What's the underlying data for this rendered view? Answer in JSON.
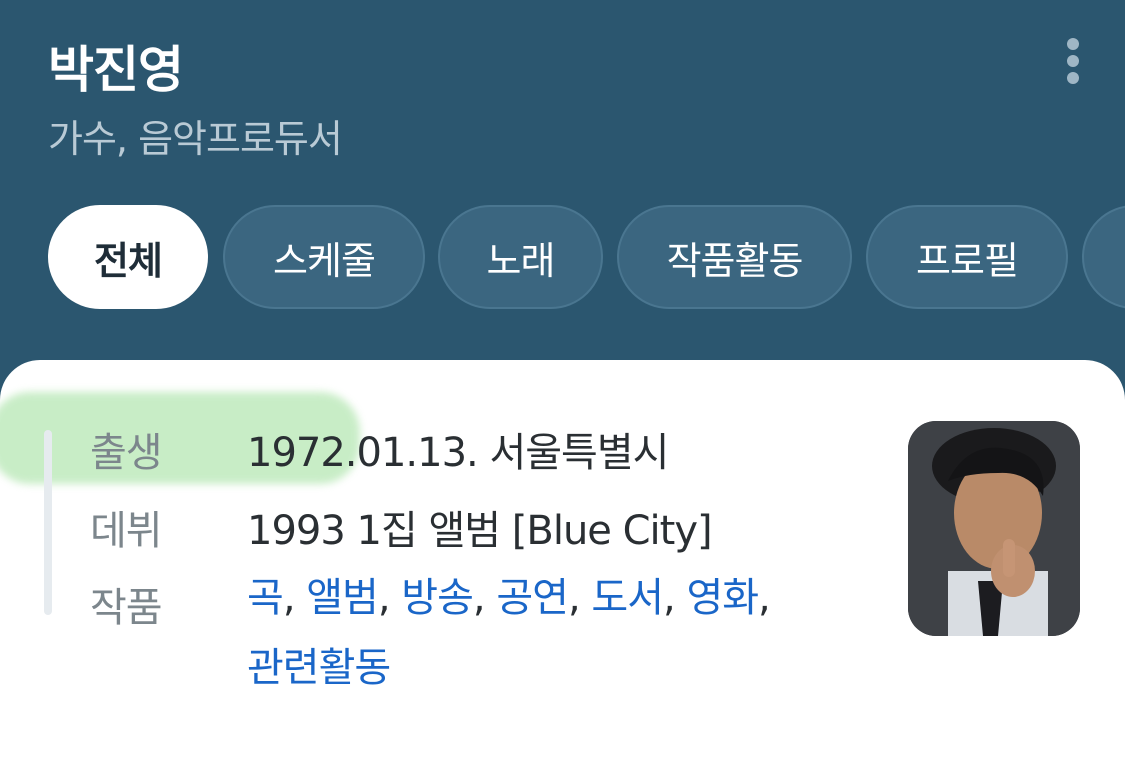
{
  "header": {
    "title": "박진영",
    "subtitle": "가수, 음악프로듀서"
  },
  "tabs": [
    {
      "label": "전체",
      "active": true
    },
    {
      "label": "스케줄",
      "active": false
    },
    {
      "label": "노래",
      "active": false
    },
    {
      "label": "작품활동",
      "active": false
    },
    {
      "label": "프로필",
      "active": false
    }
  ],
  "profile": {
    "birth_label": "출생",
    "birth_value": "1972.01.13. 서울특별시",
    "debut_label": "데뷔",
    "debut_value": "1993 1집 앨범 [Blue City]",
    "works_label": "작품",
    "works_links": [
      "곡",
      "앨범",
      "방송",
      "공연",
      "도서",
      "영화",
      "관련활동"
    ]
  },
  "colors": {
    "header_bg": "#2b566f",
    "link": "#1a66c8",
    "highlight": "#bfeabd"
  }
}
